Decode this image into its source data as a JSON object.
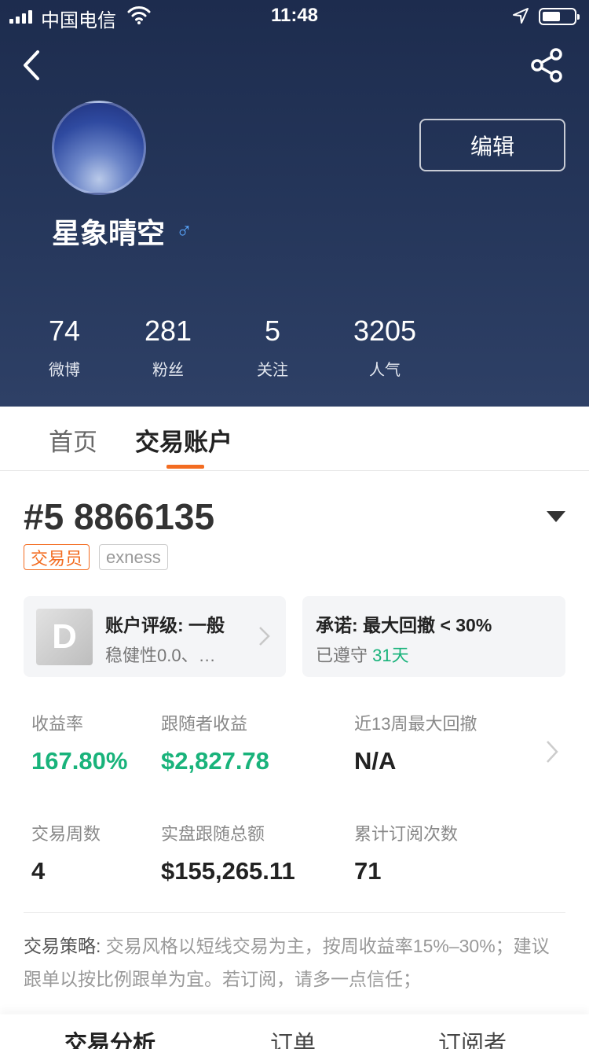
{
  "status_bar": {
    "carrier": "中国电信",
    "time": "11:48"
  },
  "profile": {
    "edit_label": "编辑",
    "name": "星象晴空",
    "gender_symbol": "♂",
    "stats": [
      {
        "value": "74",
        "label": "微博"
      },
      {
        "value": "281",
        "label": "粉丝"
      },
      {
        "value": "5",
        "label": "关注"
      },
      {
        "value": "3205",
        "label": "人气"
      }
    ]
  },
  "tabs": [
    {
      "label": "首页",
      "active": false
    },
    {
      "label": "交易账户",
      "active": true
    }
  ],
  "account": {
    "number": "#5 8866135",
    "role_badge": "交易员",
    "broker_badge": "exness",
    "rating_grade": "D",
    "rating_title": "账户评级: 一般",
    "rating_sub": "稳健性0.0、…",
    "promise_title": "承诺: 最大回撤 < 30%",
    "promise_kept_label": "已遵守",
    "promise_kept_days": "31天"
  },
  "metrics": [
    {
      "label": "收益率",
      "value": "167.80%"
    },
    {
      "label": "跟随者收益",
      "value": "$2,827.78"
    },
    {
      "label": "近13周最大回撤",
      "value": "N/A"
    },
    {
      "label": "交易周数",
      "value": "4"
    },
    {
      "label": "实盘跟随总额",
      "value": "$155,265.11"
    },
    {
      "label": "累计订阅次数",
      "value": "71"
    }
  ],
  "strategy": {
    "label": "交易策略:",
    "text": "交易风格以短线交易为主，按周收益率15%–30%；建议跟单以按比例跟单为宜。若订阅，请多一点信任；"
  },
  "bottom_tabs": [
    {
      "label": "交易分析",
      "active": true
    },
    {
      "label": "订单",
      "active": false
    },
    {
      "label": "订阅者",
      "active": false
    }
  ],
  "colors": {
    "accent": "#f36c21",
    "positive": "#19b37b",
    "header_bg": "#243559"
  }
}
